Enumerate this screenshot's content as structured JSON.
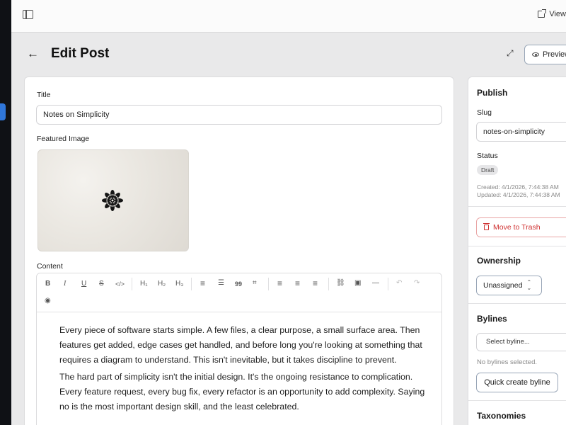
{
  "topbar": {
    "view_label": "View"
  },
  "header": {
    "title": "Edit Post",
    "preview_label": "Preview"
  },
  "editor": {
    "title_label": "Title",
    "title_value": "Notes on Simplicity",
    "featured_image_label": "Featured Image",
    "content_label": "Content",
    "toolbar": {
      "bold": "B",
      "italic": "I",
      "underline": "U",
      "strike": "S",
      "code": "</>",
      "h1": "H₁",
      "h2": "H₂",
      "h3": "H₃",
      "bullet_list": "≡",
      "ordered_list": "☰",
      "blockquote": "99",
      "code_block": "⌗",
      "align_left": "≡",
      "align_center": "≡",
      "align_right": "≡",
      "link": "⛓",
      "image": "▣",
      "hr": "—",
      "undo": "↶",
      "redo": "↷",
      "preview": "◉"
    },
    "paragraphs": [
      "Every piece of software starts simple. A few files, a clear purpose, a small surface area. Then features get added, edge cases get handled, and before long you're looking at something that requires a diagram to understand. This isn't inevitable, but it takes discipline to prevent.",
      "The hard part of simplicity isn't the initial design. It's the ongoing resistance to complication. Every feature request, every bug fix, every refactor is an opportunity to add complexity. Saying no is the most important design skill, and the least celebrated."
    ]
  },
  "publish": {
    "title": "Publish",
    "slug_label": "Slug",
    "slug_value": "notes-on-simplicity",
    "status_label": "Status",
    "status_value": "Draft",
    "created": "Created: 4/1/2026, 7:44:38 AM",
    "updated": "Updated: 4/1/2026, 7:44:38 AM",
    "trash_label": "Move to Trash"
  },
  "ownership": {
    "title": "Ownership",
    "value": "Unassigned"
  },
  "bylines": {
    "title": "Bylines",
    "select_placeholder": "Select byline...",
    "empty_text": "No bylines selected.",
    "quick_create_label": "Quick create byline"
  },
  "taxonomies": {
    "title": "Taxonomies"
  },
  "colors": {
    "accent": "#2f76d9",
    "danger": "#cf3030",
    "rail": "#0f1115"
  }
}
